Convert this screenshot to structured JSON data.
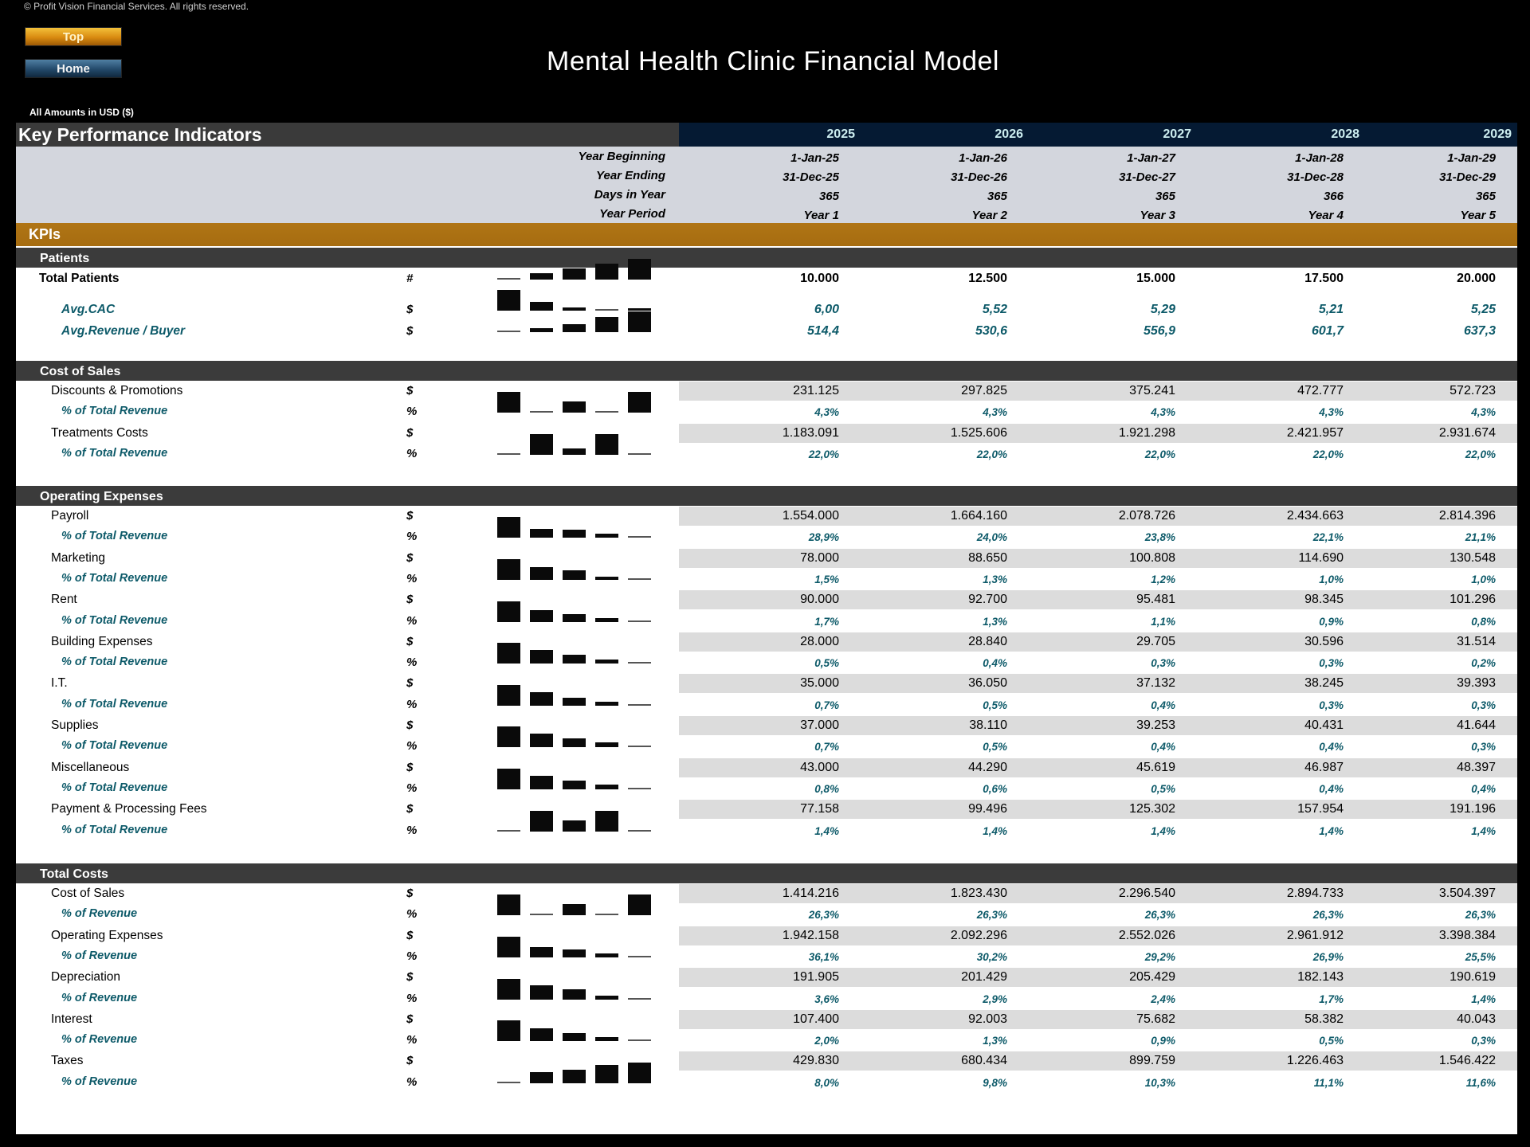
{
  "copyright": "© Profit Vision Financial Services. All rights reserved.",
  "nav": {
    "top_label": "Top",
    "home_label": "Home"
  },
  "title": "Mental Health Clinic Financial Model",
  "currency_note": "All Amounts in  USD ($)",
  "kpi_header": {
    "title": "Key Performance Indicators",
    "years": [
      "2025",
      "2026",
      "2027",
      "2028",
      "2029"
    ]
  },
  "period_rows": [
    {
      "label": "Year Beginning",
      "values": [
        "1-Jan-25",
        "1-Jan-26",
        "1-Jan-27",
        "1-Jan-28",
        "1-Jan-29"
      ]
    },
    {
      "label": "Year Ending",
      "values": [
        "31-Dec-25",
        "31-Dec-26",
        "31-Dec-27",
        "31-Dec-28",
        "31-Dec-29"
      ]
    },
    {
      "label": "Days in Year",
      "values": [
        "365",
        "365",
        "365",
        "366",
        "365"
      ]
    },
    {
      "label": "Year Period",
      "values": [
        "Year 1",
        "Year 2",
        "Year 3",
        "Year 4",
        "Year 5"
      ]
    }
  ],
  "kpis_label": "KPIs",
  "sections": {
    "patients": {
      "title": "Patients",
      "rows": [
        {
          "label": "Total Patients",
          "unit": "#",
          "values": [
            "10.000",
            "12.500",
            "15.000",
            "17.500",
            "20.000"
          ],
          "spark": [
            10000,
            12500,
            15000,
            17500,
            20000
          ]
        },
        {
          "label": "Avg.CAC",
          "unit": "$",
          "values": [
            "6,00",
            "5,52",
            "5,29",
            "5,21",
            "5,25"
          ],
          "spark": [
            6.0,
            5.52,
            5.29,
            5.21,
            5.25
          ]
        },
        {
          "label": "Avg.Revenue / Buyer",
          "unit": "$",
          "values": [
            "514,4",
            "530,6",
            "556,9",
            "601,7",
            "637,3"
          ],
          "spark": [
            514.4,
            530.6,
            556.9,
            601.7,
            637.3
          ]
        }
      ]
    },
    "cost_of_sales": {
      "title": "Cost of Sales",
      "rows": [
        {
          "label": "Discounts & Promotions",
          "unit": "$",
          "values": [
            "231.125",
            "297.825",
            "375.241",
            "472.777",
            "572.723"
          ],
          "pct_label": "% of Total Revenue",
          "pct_unit": "%",
          "pct": [
            "4,3%",
            "4,3%",
            "4,3%",
            "4,3%",
            "4,3%"
          ],
          "spark": [
            4.34,
            4.3,
            4.32,
            4.3,
            4.34
          ]
        },
        {
          "label": "Treatments Costs",
          "unit": "$",
          "values": [
            "1.183.091",
            "1.525.606",
            "1.921.298",
            "2.421.957",
            "2.931.674"
          ],
          "pct_label": "% of Total Revenue",
          "pct_unit": "%",
          "pct": [
            "22,0%",
            "22,0%",
            "22,0%",
            "22,0%",
            "22,0%"
          ],
          "spark": [
            21.98,
            22.02,
            21.99,
            22.02,
            21.98
          ]
        }
      ]
    },
    "operating_expenses": {
      "title": "Operating Expenses",
      "rows": [
        {
          "label": "Payroll",
          "unit": "$",
          "values": [
            "1.554.000",
            "1.664.160",
            "2.078.726",
            "2.434.663",
            "2.814.396"
          ],
          "pct_label": "% of Total Revenue",
          "pct_unit": "%",
          "pct": [
            "28,9%",
            "24,0%",
            "23,8%",
            "22,1%",
            "21,1%"
          ],
          "spark": [
            28.9,
            24.0,
            23.8,
            22.1,
            21.1
          ]
        },
        {
          "label": "Marketing",
          "unit": "$",
          "values": [
            "78.000",
            "88.650",
            "100.808",
            "114.690",
            "130.548"
          ],
          "pct_label": "% of Total Revenue",
          "pct_unit": "%",
          "pct": [
            "1,5%",
            "1,3%",
            "1,2%",
            "1,0%",
            "1,0%"
          ],
          "spark": [
            1.5,
            1.3,
            1.2,
            1.05,
            1.0
          ]
        },
        {
          "label": "Rent",
          "unit": "$",
          "values": [
            "90.000",
            "92.700",
            "95.481",
            "98.345",
            "101.296"
          ],
          "pct_label": "% of Total Revenue",
          "pct_unit": "%",
          "pct": [
            "1,7%",
            "1,3%",
            "1,1%",
            "0,9%",
            "0,8%"
          ],
          "spark": [
            1.7,
            1.3,
            1.1,
            0.9,
            0.8
          ]
        },
        {
          "label": "Building Expenses",
          "unit": "$",
          "values": [
            "28.000",
            "28.840",
            "29.705",
            "30.596",
            "31.514"
          ],
          "pct_label": "% of Total Revenue",
          "pct_unit": "%",
          "pct": [
            "0,5%",
            "0,4%",
            "0,3%",
            "0,3%",
            "0,2%"
          ],
          "spark": [
            0.52,
            0.42,
            0.34,
            0.28,
            0.24
          ]
        },
        {
          "label": "I.T.",
          "unit": "$",
          "values": [
            "35.000",
            "36.050",
            "37.132",
            "38.245",
            "39.393"
          ],
          "pct_label": "% of Total Revenue",
          "pct_unit": "%",
          "pct": [
            "0,7%",
            "0,5%",
            "0,4%",
            "0,3%",
            "0,3%"
          ],
          "spark": [
            0.65,
            0.52,
            0.42,
            0.35,
            0.3
          ]
        },
        {
          "label": "Supplies",
          "unit": "$",
          "values": [
            "37.000",
            "38.110",
            "39.253",
            "40.431",
            "41.644"
          ],
          "pct_label": "% of Total Revenue",
          "pct_unit": "%",
          "pct": [
            "0,7%",
            "0,5%",
            "0,4%",
            "0,4%",
            "0,3%"
          ],
          "spark": [
            0.69,
            0.55,
            0.45,
            0.37,
            0.31
          ]
        },
        {
          "label": "Miscellaneous",
          "unit": "$",
          "values": [
            "43.000",
            "44.290",
            "45.619",
            "46.987",
            "48.397"
          ],
          "pct_label": "% of Total Revenue",
          "pct_unit": "%",
          "pct": [
            "0,8%",
            "0,6%",
            "0,5%",
            "0,4%",
            "0,4%"
          ],
          "spark": [
            0.8,
            0.64,
            0.52,
            0.43,
            0.36
          ]
        },
        {
          "label": "Payment & Processing Fees",
          "unit": "$",
          "values": [
            "77.158",
            "99.496",
            "125.302",
            "157.954",
            "191.196"
          ],
          "pct_label": "% of Total Revenue",
          "pct_unit": "%",
          "pct": [
            "1,4%",
            "1,4%",
            "1,4%",
            "1,4%",
            "1,4%"
          ],
          "spark": [
            1.434,
            1.436,
            1.435,
            1.436,
            1.434
          ]
        }
      ]
    },
    "total_costs": {
      "title": "Total Costs",
      "rows": [
        {
          "label": "Cost of Sales",
          "unit": "$",
          "values": [
            "1.414.216",
            "1.823.430",
            "2.296.540",
            "2.894.733",
            "3.504.397"
          ],
          "pct_label": "% of Revenue",
          "pct_unit": "%",
          "pct": [
            "26,3%",
            "26,3%",
            "26,3%",
            "26,3%",
            "26,3%"
          ],
          "spark": [
            26.32,
            26.3,
            26.31,
            26.3,
            26.32
          ]
        },
        {
          "label": "Operating Expenses",
          "unit": "$",
          "values": [
            "1.942.158",
            "2.092.296",
            "2.552.026",
            "2.961.912",
            "3.398.384"
          ],
          "pct_label": "% of Revenue",
          "pct_unit": "%",
          "pct": [
            "36,1%",
            "30,2%",
            "29,2%",
            "26,9%",
            "25,5%"
          ],
          "spark": [
            36.1,
            30.2,
            29.2,
            26.9,
            25.5
          ]
        },
        {
          "label": "Depreciation",
          "unit": "$",
          "values": [
            "191.905",
            "201.429",
            "205.429",
            "182.143",
            "190.619"
          ],
          "pct_label": "% of Revenue",
          "pct_unit": "%",
          "pct": [
            "3,6%",
            "2,9%",
            "2,4%",
            "1,7%",
            "1,4%"
          ],
          "spark": [
            3.6,
            2.9,
            2.4,
            1.7,
            1.4
          ]
        },
        {
          "label": "Interest",
          "unit": "$",
          "values": [
            "107.400",
            "92.003",
            "75.682",
            "58.382",
            "40.043"
          ],
          "pct_label": "% of Revenue",
          "pct_unit": "%",
          "pct": [
            "2,0%",
            "1,3%",
            "0,9%",
            "0,5%",
            "0,3%"
          ],
          "spark": [
            2.0,
            1.3,
            0.9,
            0.5,
            0.3
          ]
        },
        {
          "label": "Taxes",
          "unit": "$",
          "values": [
            "429.830",
            "680.434",
            "899.759",
            "1.226.463",
            "1.546.422"
          ],
          "pct_label": "% of Revenue",
          "pct_unit": "%",
          "pct": [
            "8,0%",
            "9,8%",
            "10,3%",
            "11,1%",
            "11,6%"
          ],
          "spark": [
            8.0,
            9.8,
            10.3,
            11.1,
            11.6
          ]
        }
      ]
    }
  }
}
